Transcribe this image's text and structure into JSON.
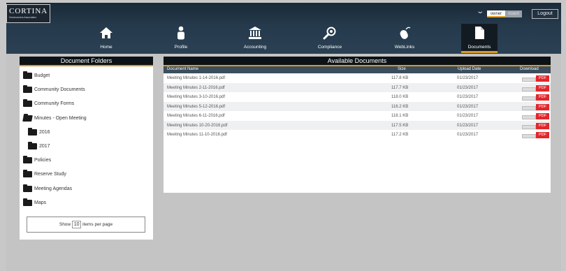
{
  "header": {
    "logo_name": "CORTINA",
    "logo_sub": "Homeowners Association",
    "role_toggle": {
      "owner": "owner",
      "board": "board"
    },
    "logout_label": "Logout"
  },
  "nav": [
    {
      "label": "Home",
      "icon": "home-icon"
    },
    {
      "label": "Profile",
      "icon": "person-icon"
    },
    {
      "label": "Accounting",
      "icon": "bank-icon"
    },
    {
      "label": "Compliance",
      "icon": "search-icon"
    },
    {
      "label": "WebLinks",
      "icon": "mouse-icon"
    },
    {
      "label": "Documents",
      "icon": "document-icon"
    }
  ],
  "folders_panel": {
    "title": "Document Folders",
    "folders": [
      {
        "label": "Budget"
      },
      {
        "label": "Community Documents"
      },
      {
        "label": "Community Forms"
      },
      {
        "label": "Minutes - Open Meeting"
      },
      {
        "label": "2016"
      },
      {
        "label": "2017"
      },
      {
        "label": "Policies"
      },
      {
        "label": "Reserve Study"
      },
      {
        "label": "Meeting Agendas"
      },
      {
        "label": "Maps"
      }
    ],
    "pager": {
      "prefix": "Show",
      "value": "10",
      "suffix": "items per page"
    }
  },
  "documents_panel": {
    "title": "Available Documents",
    "columns": {
      "name": "Document Name",
      "size": "Size",
      "date": "Upload Date",
      "download": "Download"
    },
    "rows": [
      {
        "name": "Meeting Minutes 1-14-2016.pdf",
        "size": "117.8 KB",
        "date": "01/23/2017",
        "download": "PDF"
      },
      {
        "name": "Meeting Minutes 2-11-2016.pdf",
        "size": "117.7 KB",
        "date": "01/23/2017",
        "download": "PDF"
      },
      {
        "name": "Meeting Minutes 3-10-2016.pdf",
        "size": "118.0 KB",
        "date": "01/23/2017",
        "download": "PDF"
      },
      {
        "name": "Meeting Minutes 5-12-2016.pdf",
        "size": "116.2 KB",
        "date": "01/23/2017",
        "download": "PDF"
      },
      {
        "name": "Meeting Minutes 6-11-2016.pdf",
        "size": "118.1 KB",
        "date": "01/23/2017",
        "download": "PDF"
      },
      {
        "name": "Meeting Minutes 10-20-2016.pdf",
        "size": "117.5 KB",
        "date": "01/23/2017",
        "download": "PDF"
      },
      {
        "name": "Meeting Minutes 11-10-2016.pdf",
        "size": "117.2 KB",
        "date": "01/23/2017",
        "download": "PDF"
      }
    ]
  },
  "colors": {
    "accent": "#d89a2a",
    "pdf_button": "#e2262a",
    "header_bg": "#253a4c"
  }
}
